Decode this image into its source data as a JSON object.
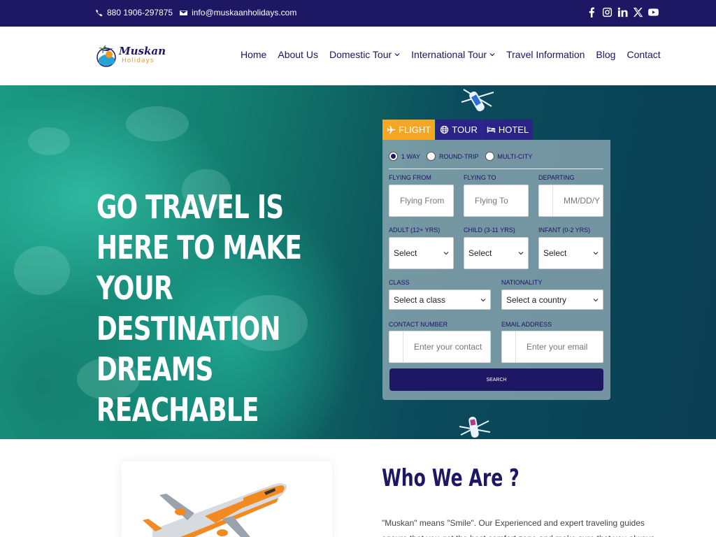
{
  "topbar": {
    "phone": "880 1906-297875",
    "email": "info@muskaanholidays.com",
    "social_icons": [
      "facebook-icon",
      "instagram-icon",
      "linkedin-icon",
      "x-icon",
      "youtube-icon"
    ]
  },
  "logo": {
    "brand_line1": "Muskan",
    "brand_line2": "Holidays"
  },
  "nav": {
    "items": [
      {
        "label": "Home",
        "dropdown": false
      },
      {
        "label": "About Us",
        "dropdown": false
      },
      {
        "label": "Domestic Tour",
        "dropdown": true
      },
      {
        "label": "International Tour",
        "dropdown": true
      },
      {
        "label": "Travel Information",
        "dropdown": false
      },
      {
        "label": "Blog",
        "dropdown": false
      },
      {
        "label": "Contact",
        "dropdown": false
      }
    ]
  },
  "hero": {
    "title": "GO TRAVEL IS HERE TO MAKE YOUR DESTINATION DREAMS REACHABLE"
  },
  "booking": {
    "tabs": [
      {
        "label": "FLIGHT",
        "icon": "plane-icon",
        "active": true
      },
      {
        "label": "TOUR",
        "icon": "globe-icon",
        "active": false
      },
      {
        "label": "HOTEL",
        "icon": "bed-icon",
        "active": false
      }
    ],
    "trip_types": [
      {
        "label": "1 WAY",
        "selected": true
      },
      {
        "label": "ROUND-TRIP",
        "selected": false
      },
      {
        "label": "MULTI-CITY",
        "selected": false
      }
    ],
    "flying_from": {
      "label": "FLYING FROM",
      "placeholder": "Flying From"
    },
    "flying_to": {
      "label": "FLYING TO",
      "placeholder": "Flying To"
    },
    "departing": {
      "label": "DEPARTING",
      "placeholder": "MM/DD/Y"
    },
    "adult": {
      "label": "ADULT (12+ YRS)",
      "value": "Select"
    },
    "child": {
      "label": "CHILD (3-11 YRS)",
      "value": "Select"
    },
    "infant": {
      "label": "INFANT (0-2 YRS)",
      "value": "Select"
    },
    "class": {
      "label": "CLASS",
      "value": "Select a class"
    },
    "nationality": {
      "label": "NATIONALITY",
      "value": "Select a country"
    },
    "contact": {
      "label": "CONTACT NUMBER",
      "placeholder": "Enter your contact"
    },
    "email": {
      "label": "EMAIL ADDRESS",
      "placeholder": "Enter your email"
    },
    "search_label": "SEARCH"
  },
  "about": {
    "title": "Who We Are ?",
    "text": "\"Muskan\" means \"Smile\". Our Experienced and expert traveling guides ensure that you got the best comfort zone and make sure that you always have a beautiful satisfactory smile"
  }
}
